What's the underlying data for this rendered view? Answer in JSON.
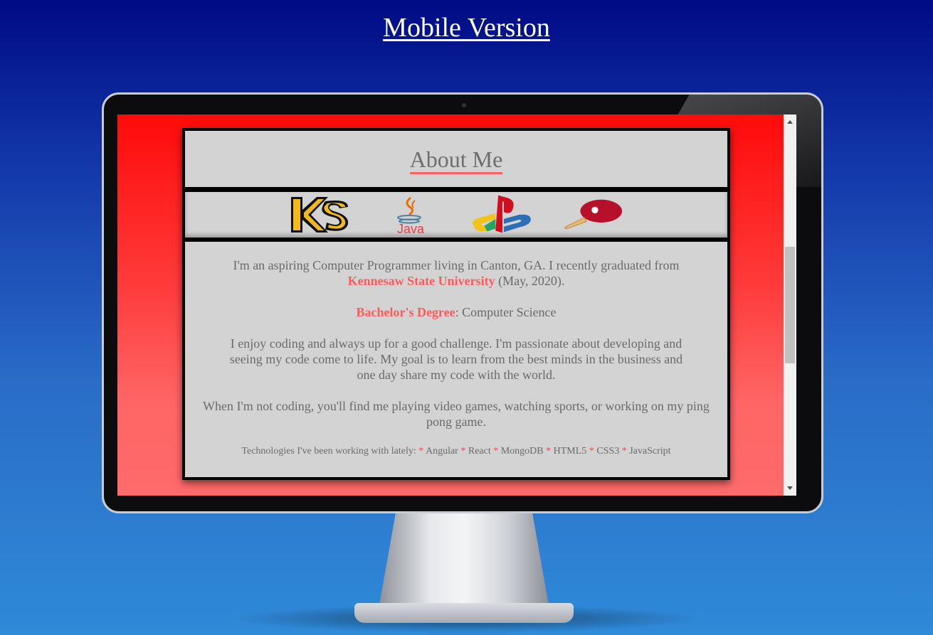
{
  "header": {
    "link_text": "Mobile Version"
  },
  "about": {
    "title": "About Me",
    "icons": [
      "ksu-logo-icon",
      "java-icon",
      "playstation-icon",
      "ping-pong-paddle-icon"
    ],
    "intro_before": "I'm an aspiring Computer Programmer living in Canton, GA. I recently graduated from",
    "university": "Kennesaw State University",
    "intro_after": "(May, 2020).",
    "degree_label": "Bachelor's Degree",
    "degree_value": ": Computer Science",
    "passion": "I enjoy coding and always up for a good challenge. I'm passionate about developing and seeing my code come to life. My goal is to learn from the best minds in the business and one day share my code with the world.",
    "hobbies": "When I'm not coding, you'll find me playing video games, watching sports, or working on my ping pong game.",
    "tech_prefix": "Technologies I've been working with lately:",
    "technologies": [
      "Angular",
      "React",
      "MongoDB",
      "HTML5",
      "CSS3",
      "JavaScript"
    ],
    "separator": "*"
  },
  "colors": {
    "accent": "#ff6262",
    "panel": "#d3d3d3",
    "screen_top": "#ff0a0a",
    "background_top": "#000a85"
  }
}
